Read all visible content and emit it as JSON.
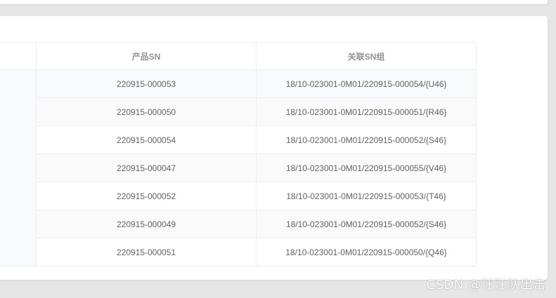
{
  "table": {
    "headers": [
      "",
      "产品SN",
      "关联SN组"
    ],
    "rows": [
      {
        "sn": "220915-000053",
        "group": "18/10-023001-0M01/220915-000054/{U46}"
      },
      {
        "sn": "220915-000050",
        "group": "18/10-023001-0M01/220915-000051/{R46}"
      },
      {
        "sn": "220915-000054",
        "group": "18/10-023001-0M01/220915-000052/{S46}"
      },
      {
        "sn": "220915-000047",
        "group": "18/10-023001-0M01/220915-000055/{V46}"
      },
      {
        "sn": "220915-000052",
        "group": "18/10-023001-0M01/220915-000053/{T46}"
      },
      {
        "sn": "220915-000049",
        "group": "18/10-023001-0M01/220915-000052/{S46}"
      },
      {
        "sn": "220915-000051",
        "group": "18/10-023001-0M01/220915-000050/{Q46}"
      }
    ]
  },
  "watermark": "CSDN @汪汪队出击",
  "colors": {
    "border": "#ebeef5",
    "header_text": "#909399",
    "cell_text": "#606266",
    "stripe": "#fafafa",
    "page_bg": "#e6e6e6"
  }
}
